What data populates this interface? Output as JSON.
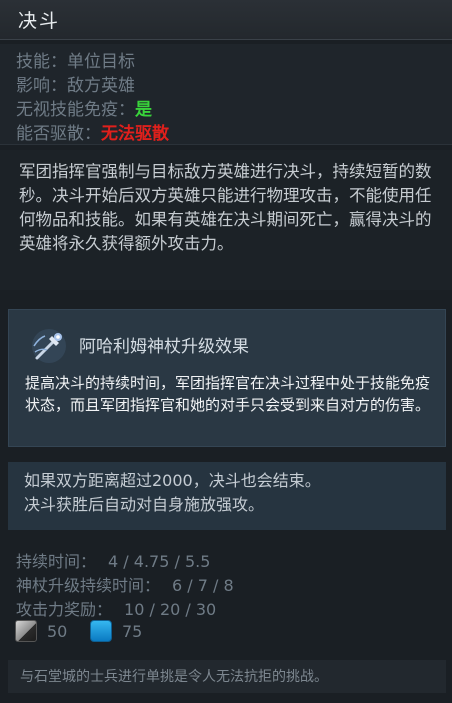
{
  "header": {
    "title": "决斗"
  },
  "info": {
    "ability_label": "技能：",
    "ability_value": "单位目标",
    "affects_label": "影响：",
    "affects_value": "敌方英雄",
    "pierce_label": "无视技能免疫：",
    "pierce_value": "是",
    "dispel_label": "能否驱散：",
    "dispel_value": "无法驱散"
  },
  "description": "军团指挥官强制与目标敌方英雄进行决斗，持续短暂的数秒。决斗开始后双方英雄只能进行物理攻击，不能使用任何物品和技能。如果有英雄在决斗期间死亡，赢得决斗的英雄将永久获得额外攻击力。",
  "aghanims": {
    "icon": "aghanims-scepter-icon",
    "title": "阿哈利姆神杖升级效果",
    "text": "提高决斗的持续时间，军团指挥官在决斗过程中处于技能免疫状态，而且军团指挥官和她的对手只会受到来自对方的伤害。"
  },
  "note": {
    "line1": "如果双方距离超过2000，决斗也会结束。",
    "line2": "决斗获胜后自动对自身施放强攻。"
  },
  "stats": {
    "duration_label": "持续时间：",
    "duration_value": "4 / 4.75 / 5.5",
    "scepter_duration_label": "神杖升级持续时间：",
    "scepter_duration_value": "6 / 7 / 8",
    "damage_label": "攻击力奖励：",
    "damage_value": "10 / 20 / 30"
  },
  "costs": {
    "cooldown_icon": "cooldown-icon",
    "cooldown": "50",
    "mana_icon": "mana-icon",
    "mana": "75"
  },
  "lore": "与石堂城的士兵进行单挑是令人无法抗拒的挑战。",
  "colors": {
    "pierce_yes": "#39d33b",
    "dispel_no": "#e0201c",
    "scepter_panel": "#2a3844"
  }
}
